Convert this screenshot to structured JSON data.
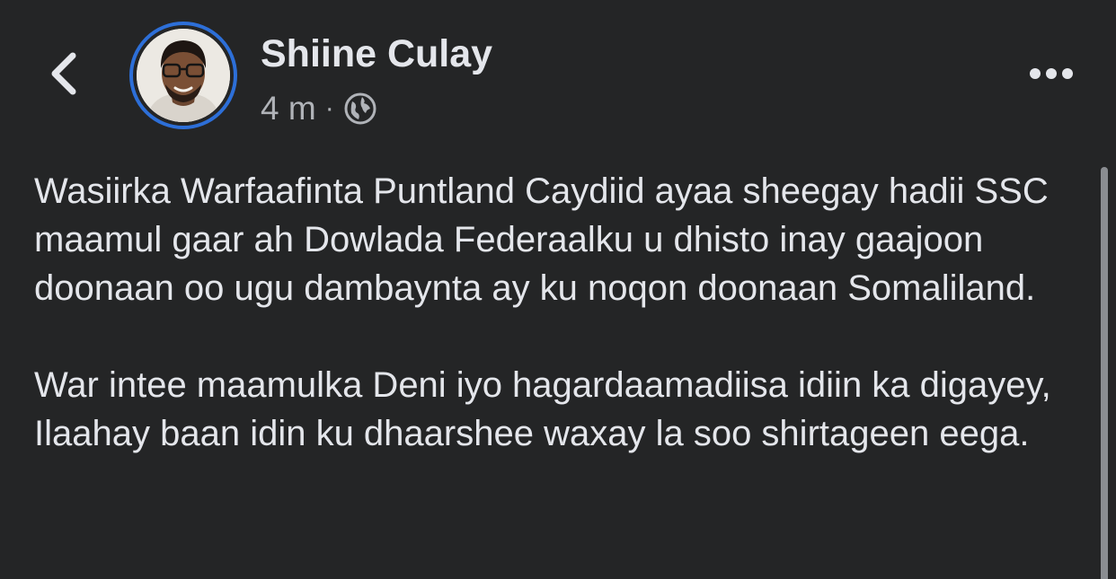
{
  "header": {
    "author_name": "Shiine Culay",
    "timestamp": "4 m",
    "separator": "·",
    "audience_icon": "globe-icon",
    "back_icon": "chevron-left-icon",
    "more_icon": "more-horizontal-icon"
  },
  "colors": {
    "background": "#242526",
    "primary_text": "#e4e6eb",
    "secondary_text": "#b0b3b8",
    "avatar_ring": "#2d6fd8"
  },
  "post": {
    "paragraphs": [
      "Wasiirka Warfaafinta Puntland Caydiid ayaa sheegay hadii SSC maamul gaar ah Dowlada Federaalku u dhisto inay gaajoon doonaan oo ugu dambaynta ay ku noqon doonaan Somaliland.",
      "War intee maamulka Deni iyo hagardaamadiisa idiin ka digayey, Ilaahay baan idin ku dhaarshee waxay la soo shirtageen eega."
    ]
  }
}
